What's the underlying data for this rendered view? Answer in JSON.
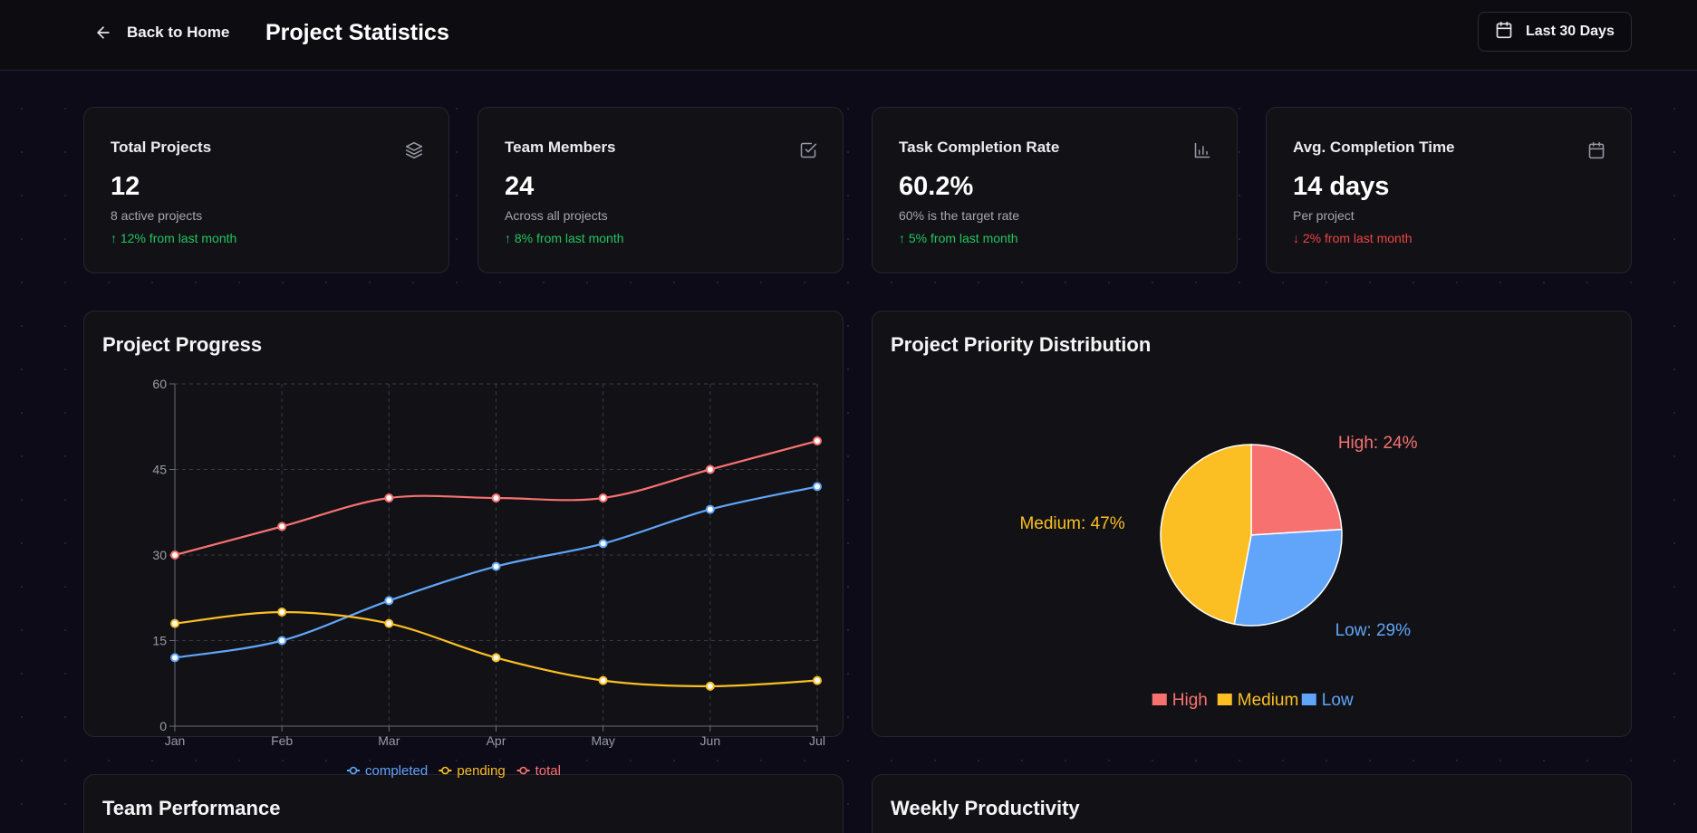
{
  "header": {
    "back_label": "Back to Home",
    "title": "Project Statistics",
    "range_label": "Last 30 Days"
  },
  "stats": [
    {
      "title": "Total Projects",
      "value": "12",
      "sub": "8 active projects",
      "change": "↑ 12% from last month",
      "trend": "up",
      "icon": "layers-icon"
    },
    {
      "title": "Team Members",
      "value": "24",
      "sub": "Across all projects",
      "change": "↑ 8% from last month",
      "trend": "up",
      "icon": "check-square-icon"
    },
    {
      "title": "Task Completion Rate",
      "value": "60.2%",
      "sub": "60% is the target rate",
      "change": "↑ 5% from last month",
      "trend": "up",
      "icon": "bar-chart-icon"
    },
    {
      "title": "Avg. Completion Time",
      "value": "14 days",
      "sub": "Per project",
      "change": "↓ 2% from last month",
      "trend": "down",
      "icon": "calendar-icon"
    }
  ],
  "panels": {
    "progress_title": "Project Progress",
    "priority_title": "Project Priority Distribution",
    "team_title": "Team Performance",
    "weekly_title": "Weekly Productivity"
  },
  "colors": {
    "completed": "#60a5fa",
    "pending": "#fbbf24",
    "total": "#f87171",
    "up": "#22c55e",
    "down": "#ef4444"
  },
  "chart_data": [
    {
      "type": "line",
      "categories": [
        "Jan",
        "Feb",
        "Mar",
        "Apr",
        "May",
        "Jun",
        "Jul"
      ],
      "ylim": [
        0,
        60
      ],
      "yticks": [
        0,
        15,
        30,
        45,
        60
      ],
      "grid": true,
      "legend": "bottom",
      "series": [
        {
          "name": "completed",
          "color": "#60a5fa",
          "values": [
            12,
            15,
            22,
            28,
            32,
            38,
            42
          ]
        },
        {
          "name": "pending",
          "color": "#fbbf24",
          "values": [
            18,
            20,
            18,
            12,
            8,
            7,
            8
          ]
        },
        {
          "name": "total",
          "color": "#f87171",
          "values": [
            30,
            35,
            40,
            40,
            40,
            45,
            50
          ]
        }
      ]
    },
    {
      "type": "pie",
      "legend": "bottom",
      "slices": [
        {
          "name": "High",
          "label": "High: 24%",
          "value": 24,
          "color": "#f87171"
        },
        {
          "name": "Low",
          "label": "Low: 29%",
          "value": 29,
          "color": "#60a5fa"
        },
        {
          "name": "Medium",
          "label": "Medium: 47%",
          "value": 47,
          "color": "#fbbf24"
        }
      ],
      "legend_order": [
        "High",
        "Medium",
        "Low"
      ]
    }
  ]
}
